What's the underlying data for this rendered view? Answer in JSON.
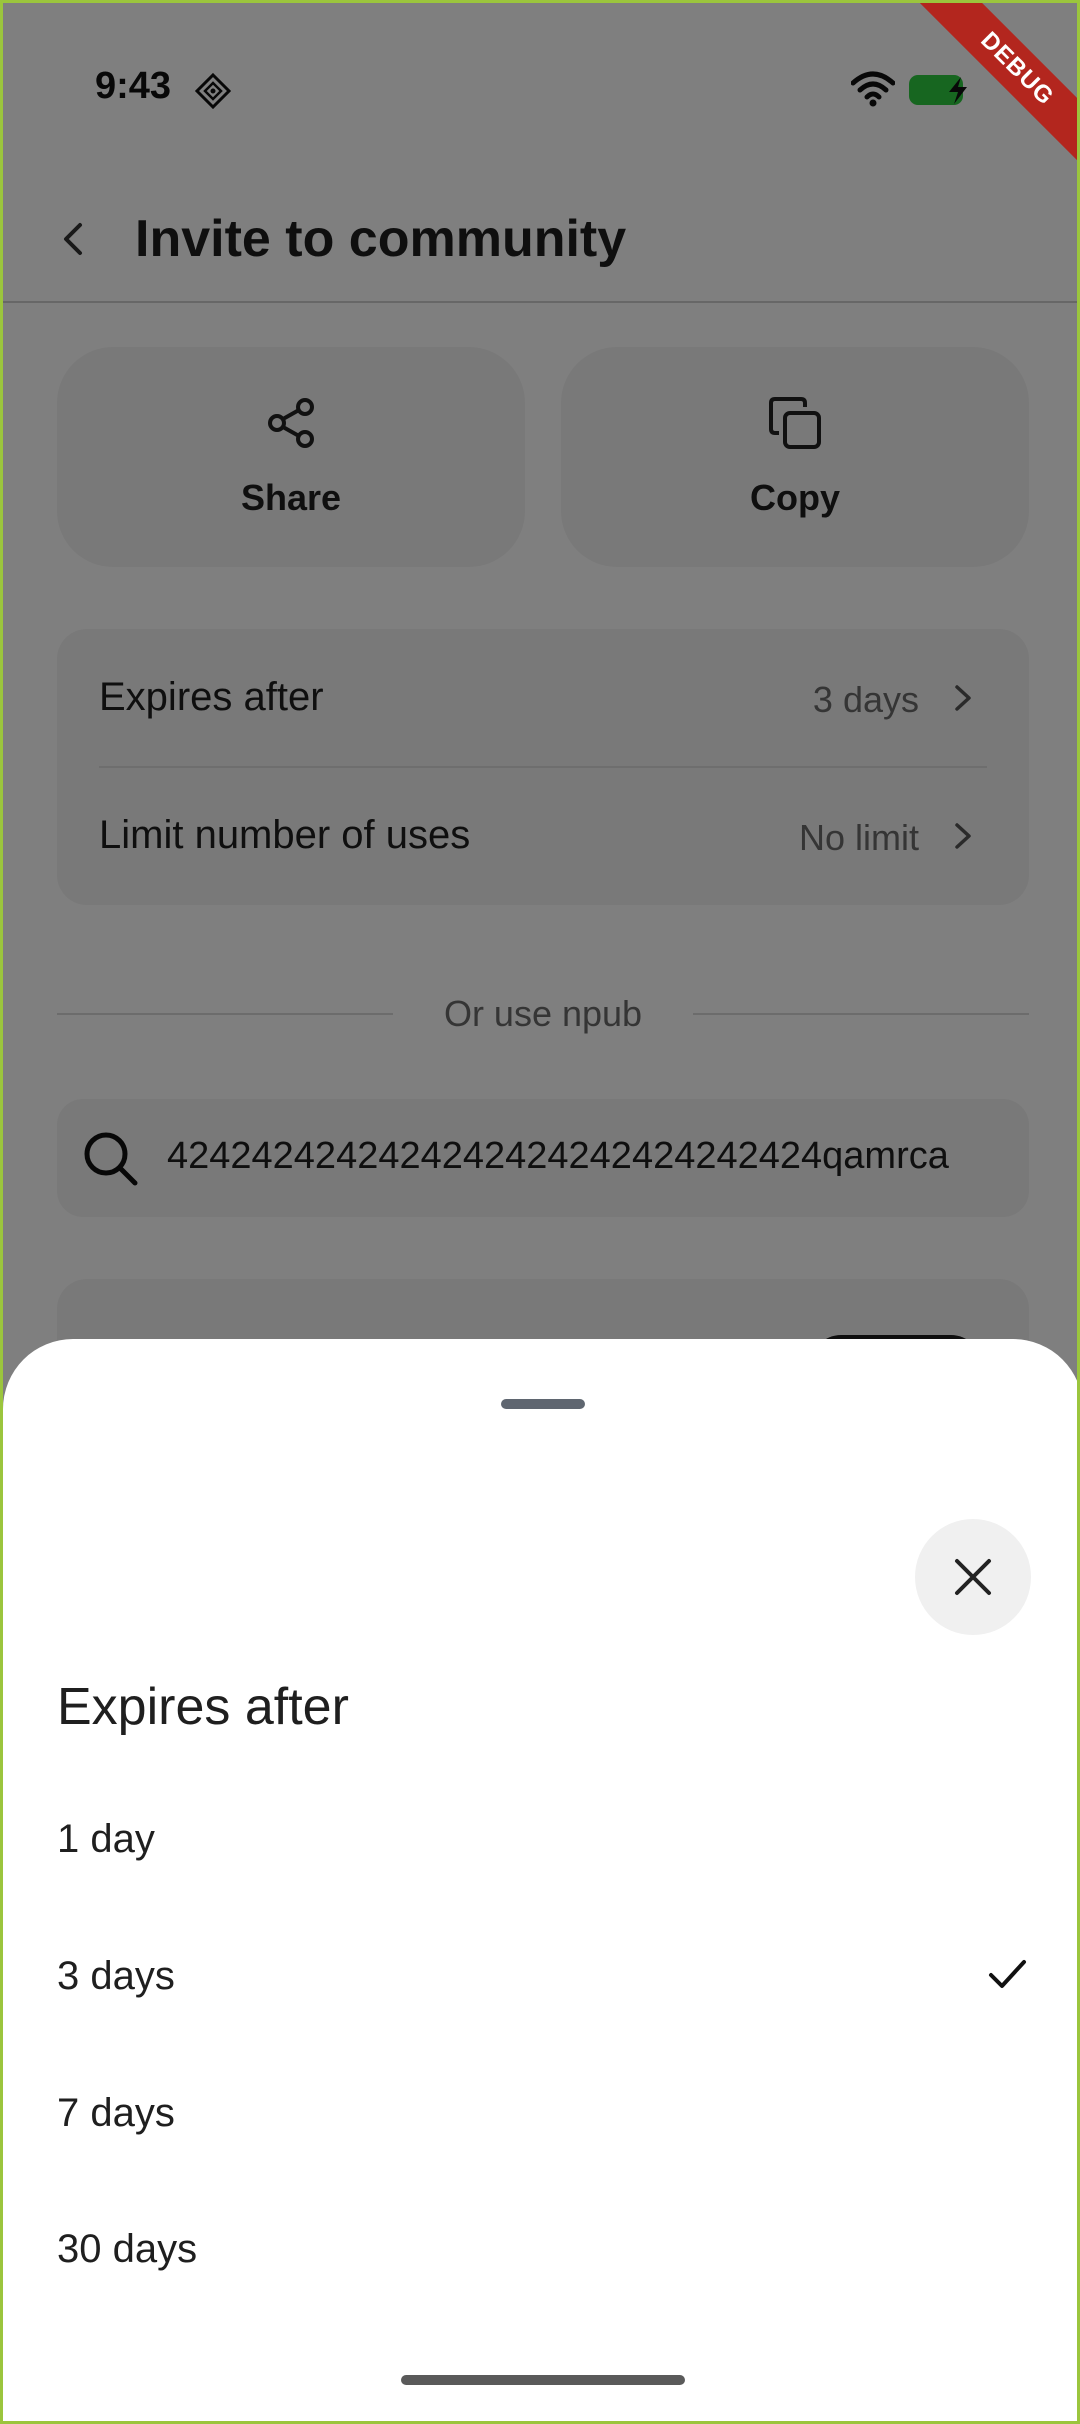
{
  "status_bar": {
    "time": "9:43",
    "battery_color": "#2ecc40"
  },
  "debug_ribbon": "DEBUG",
  "app_bar": {
    "title": "Invite to community"
  },
  "actions": [
    {
      "label": "Share",
      "icon": "share-icon"
    },
    {
      "label": "Copy",
      "icon": "copy-icon"
    }
  ],
  "settings": {
    "expires": {
      "label": "Expires after",
      "value": "3 days"
    },
    "limit": {
      "label": "Limit number of uses",
      "value": "No limit"
    }
  },
  "divider_text": "Or use npub",
  "npub_field": {
    "value": "4242424242424242424242424242424qamrca"
  },
  "sheet": {
    "title": "Expires after",
    "options": [
      {
        "label": "1 day",
        "selected": false
      },
      {
        "label": "3 days",
        "selected": true
      },
      {
        "label": "7 days",
        "selected": false
      },
      {
        "label": "30 days",
        "selected": false
      }
    ]
  }
}
